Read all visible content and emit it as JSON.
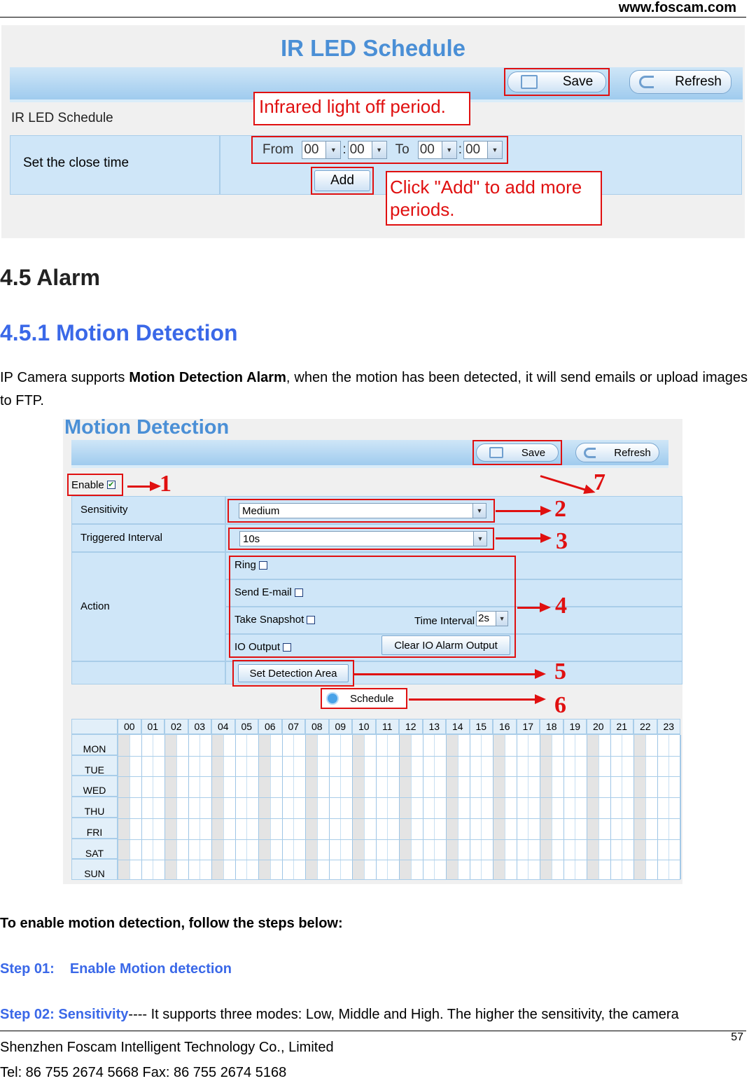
{
  "header": {
    "site": "www.foscam.com"
  },
  "ir_panel": {
    "title": "IR LED Schedule",
    "save_label": "Save",
    "refresh_label": "Refresh",
    "section_label": "IR LED Schedule",
    "row_label": "Set the close time",
    "from_label": "From",
    "to_label": "To",
    "from_hour": "00",
    "from_min": "00",
    "to_hour": "00",
    "to_min": "00",
    "time_sep": ":",
    "add_label": "Add",
    "note_off_period": "Infrared light off period.",
    "note_add_more": "Click \"Add\" to add more periods."
  },
  "headings": {
    "alarm": "4.5 Alarm",
    "motion": "4.5.1 Motion Detection"
  },
  "intro": {
    "before": "IP Camera supports ",
    "bold": "Motion Detection Alarm",
    "after": ", when the motion has been detected, it will send emails or upload images to FTP."
  },
  "md_panel": {
    "title": "Motion Detection",
    "save_label": "Save",
    "refresh_label": "Refresh",
    "enable_label": "Enable",
    "sensitivity_label": "Sensitivity",
    "sensitivity_value": "Medium",
    "interval_label": "Triggered Interval",
    "interval_value": "10s",
    "action_label": "Action",
    "ring_label": "Ring",
    "email_label": "Send E-mail",
    "snapshot_label": "Take Snapshot",
    "time_interval_label": "Time Interval",
    "time_interval_value": "2s",
    "io_label": "IO Output",
    "clear_io_label": "Clear IO Alarm Output",
    "set_area_label": "Set Detection Area",
    "schedule_label": "Schedule",
    "callouts": [
      "1",
      "2",
      "3",
      "4",
      "5",
      "6",
      "7"
    ],
    "hours": [
      "00",
      "01",
      "02",
      "03",
      "04",
      "05",
      "06",
      "07",
      "08",
      "09",
      "10",
      "11",
      "12",
      "13",
      "14",
      "15",
      "16",
      "17",
      "18",
      "19",
      "20",
      "21",
      "22",
      "23"
    ],
    "days": [
      "MON",
      "TUE",
      "WED",
      "THU",
      "FRI",
      "SAT",
      "SUN"
    ]
  },
  "steps": {
    "intro": "To enable motion detection, follow the steps below:",
    "step1_label": "Step 01:",
    "step1_text": "Enable Motion detection",
    "step2_label": "Step 02: Sensitivity",
    "step2_text": "---- It supports three modes: Low, Middle and High. The higher the sensitivity, the camera"
  },
  "footer": {
    "page": "57",
    "company": "Shenzhen Foscam Intelligent Technology Co., Limited",
    "contact": "Tel: 86 755 2674 5668 Fax: 86 755 2674 5168"
  }
}
